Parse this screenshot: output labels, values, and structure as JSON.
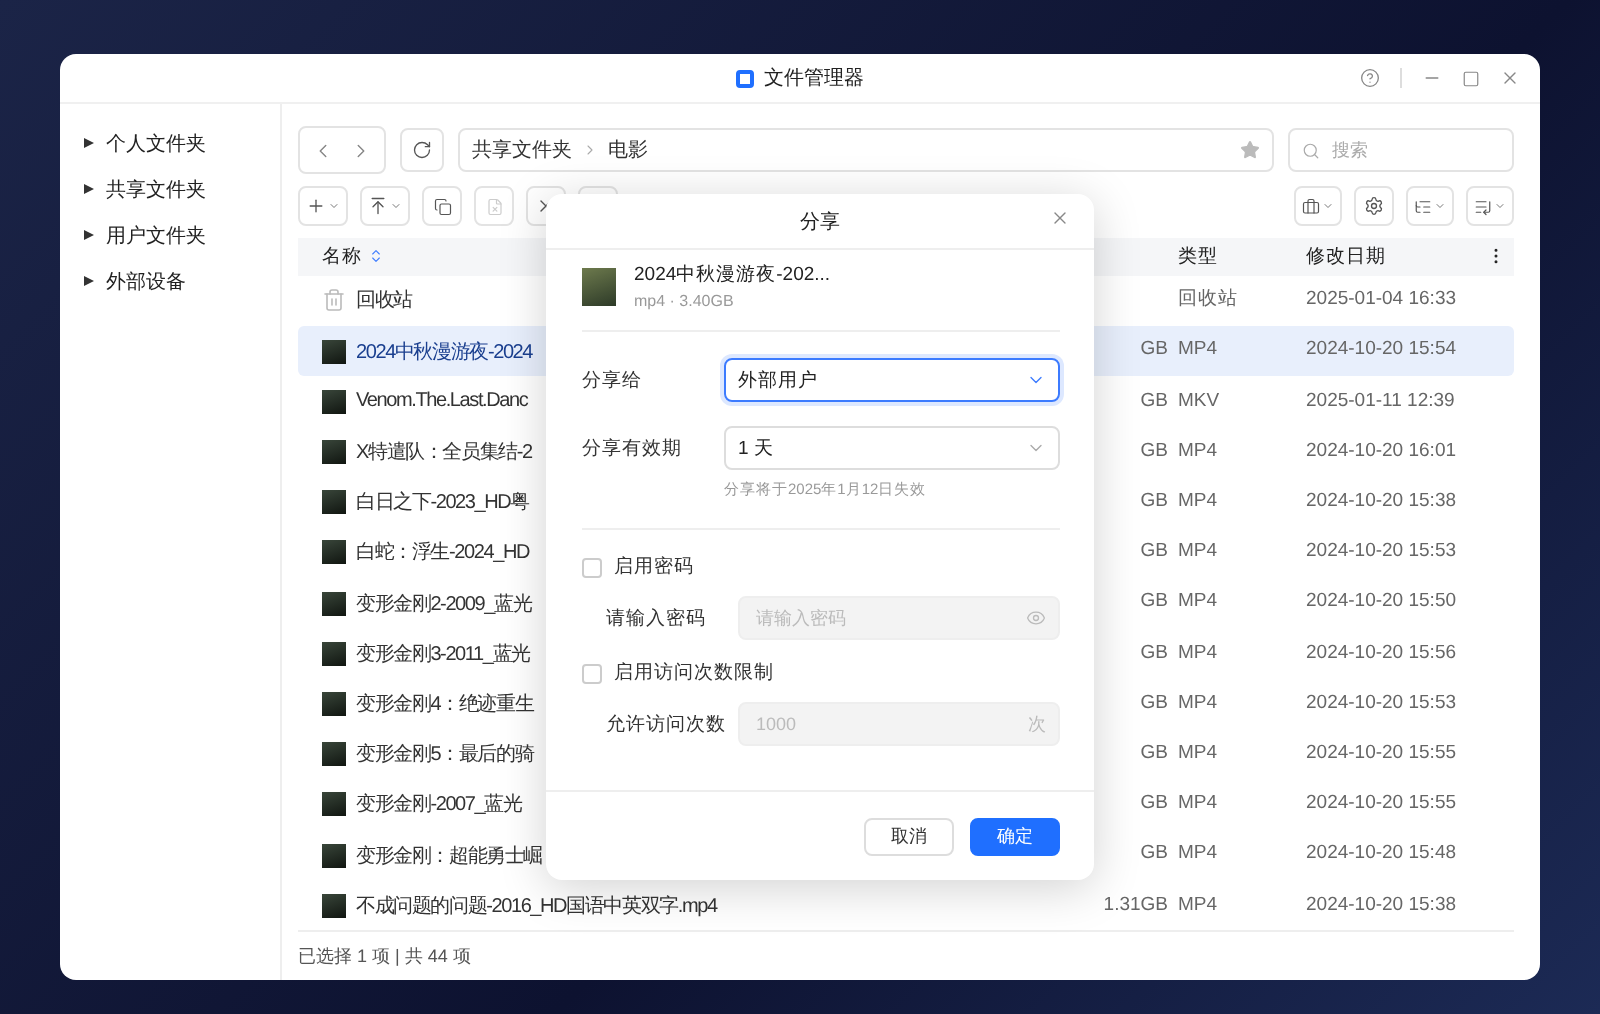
{
  "window": {
    "title": "文件管理器"
  },
  "sidebar": {
    "items": [
      {
        "label": "个人文件夹",
        "expanded": false
      },
      {
        "label": "共享文件夹",
        "expanded": false
      },
      {
        "label": "用户文件夹",
        "expanded": false
      },
      {
        "label": "外部设备",
        "expanded": false
      }
    ]
  },
  "path": [
    "共享文件夹",
    "电影"
  ],
  "search": {
    "placeholder": "搜索"
  },
  "table": {
    "columns": [
      {
        "label": "名称",
        "sorted": true
      },
      {
        "label": "类型"
      },
      {
        "label": "修改日期"
      }
    ],
    "rows": [
      {
        "kind": "trash",
        "name": "回收站",
        "type": "回收站",
        "modified": "2025-01-04 16:33",
        "selected": false
      },
      {
        "kind": "video",
        "name": "2024中秋漫游夜-2024",
        "size": "GB",
        "type": "MP4",
        "modified": "2024-10-20 15:54",
        "selected": true
      },
      {
        "kind": "video",
        "name": "Venom.The.Last.Danc",
        "size": "GB",
        "type": "MKV",
        "modified": "2025-01-11 12:39",
        "selected": false
      },
      {
        "kind": "video",
        "name": "X特遣队：全员集结-2",
        "size": "GB",
        "type": "MP4",
        "modified": "2024-10-20 16:01",
        "selected": false
      },
      {
        "kind": "video",
        "name": "白日之下-2023_HD粤",
        "size": "GB",
        "type": "MP4",
        "modified": "2024-10-20 15:38",
        "selected": false
      },
      {
        "kind": "video",
        "name": "白蛇：浮生-2024_HD",
        "size": "GB",
        "type": "MP4",
        "modified": "2024-10-20 15:53",
        "selected": false
      },
      {
        "kind": "video",
        "name": "变形金刚2-2009_蓝光",
        "size": "GB",
        "type": "MP4",
        "modified": "2024-10-20 15:50",
        "selected": false
      },
      {
        "kind": "video",
        "name": "变形金刚3-2011_蓝光",
        "size": "GB",
        "type": "MP4",
        "modified": "2024-10-20 15:56",
        "selected": false
      },
      {
        "kind": "video",
        "name": "变形金刚4：绝迹重生",
        "size": "GB",
        "type": "MP4",
        "modified": "2024-10-20 15:53",
        "selected": false
      },
      {
        "kind": "video",
        "name": "变形金刚5：最后的骑",
        "size": "GB",
        "type": "MP4",
        "modified": "2024-10-20 15:55",
        "selected": false
      },
      {
        "kind": "video",
        "name": "变形金刚-2007_蓝光",
        "size": "GB",
        "type": "MP4",
        "modified": "2024-10-20 15:55",
        "selected": false
      },
      {
        "kind": "video",
        "name": "变形金刚：超能勇士崛",
        "size": "GB",
        "type": "MP4",
        "modified": "2024-10-20 15:48",
        "selected": false
      },
      {
        "kind": "video",
        "name": "不成问题的问题-2016_HD国语中英双字.mp4",
        "size": "1.31GB",
        "type": "MP4",
        "modified": "2024-10-20 15:38",
        "selected": false
      }
    ]
  },
  "status_bar": "已选择 1 项 | 共 44 项",
  "dialog": {
    "title": "分享",
    "file": {
      "name": "2024中秋漫游夜-202...",
      "meta": "mp4 · 3.40GB"
    },
    "share_to": {
      "label": "分享给",
      "value": "外部用户",
      "focused": true
    },
    "validity": {
      "label": "分享有效期",
      "value": "1 天",
      "hint": "分享将于2025年1月12日失效",
      "focused": false
    },
    "password": {
      "label": "启用密码",
      "checked": false,
      "field_label": "请输入密码",
      "placeholder": "请输入密码"
    },
    "visit_limit": {
      "label": "启用访问次数限制",
      "checked": false,
      "field_label": "允许访问次数",
      "value": "1000",
      "suffix": "次"
    },
    "buttons": [
      {
        "label": "取消",
        "kind": "secondary"
      },
      {
        "label": "确定",
        "kind": "primary"
      }
    ]
  }
}
